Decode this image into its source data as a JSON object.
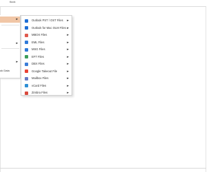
{
  "app": {
    "title": "tlook"
  },
  "parent_menu": {
    "items": [
      {
        "label": "",
        "has_submenu": true,
        "highlighted": true
      },
      {
        "label": "",
        "has_submenu": true,
        "highlighted": false
      },
      {
        "label": "",
        "has_submenu": true,
        "highlighted": false
      },
      {
        "label": "ok Data",
        "has_submenu": false,
        "highlighted": false
      }
    ]
  },
  "submenu": {
    "items": [
      {
        "label": "Outlook PST / OST Files",
        "icon": "outlook-icon",
        "color": "#1f6fd6"
      },
      {
        "label": "Outlook for Mac OLM Files",
        "icon": "outlook-mac-icon",
        "color": "#1f6fd6"
      },
      {
        "label": "MBOX Files",
        "icon": "mbox-icon",
        "color": "#e05a4e"
      },
      {
        "label": "EML Files",
        "icon": "eml-icon",
        "color": "#2f7ad9"
      },
      {
        "label": "MSG Files",
        "icon": "msg-icon",
        "color": "#2f7ad9"
      },
      {
        "label": "EFT Files",
        "icon": "eft-icon",
        "color": "#3c9d5a"
      },
      {
        "label": "DBX Files",
        "icon": "dbx-icon",
        "color": "#3b7dd8"
      },
      {
        "label": "Google Takeout File",
        "icon": "google-icon",
        "color": "#ea4335"
      },
      {
        "label": "Mailbox Files",
        "icon": "mailbox-icon",
        "color": "#6a7cc4"
      },
      {
        "label": "vCard Files",
        "icon": "vcard-icon",
        "color": "#2d8fd5"
      },
      {
        "label": "Zimbra Files",
        "icon": "zimbra-icon",
        "color": "#d94a3d"
      }
    ],
    "chevron": "▸"
  }
}
